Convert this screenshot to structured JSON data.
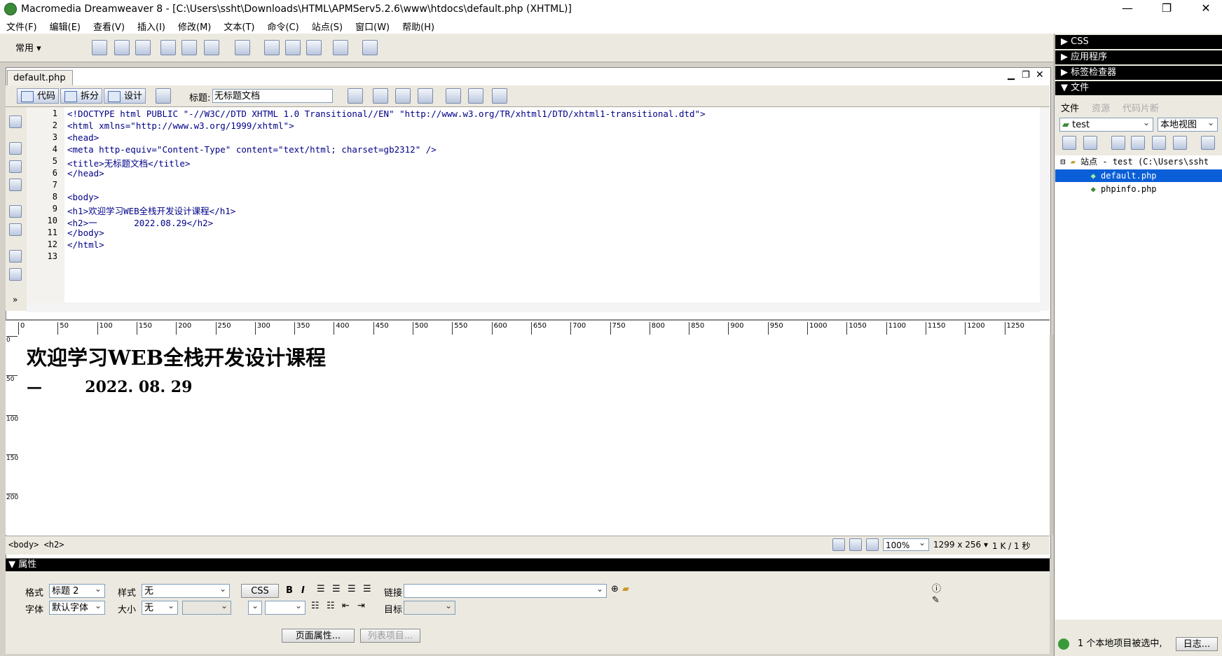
{
  "window": {
    "title": "Macromedia Dreamweaver 8 - [C:\\Users\\ssht\\Downloads\\HTML\\APMServ5.2.6\\www\\htdocs\\default.php (XHTML)]"
  },
  "menu": [
    "文件(F)",
    "编辑(E)",
    "查看(V)",
    "插入(I)",
    "修改(M)",
    "文本(T)",
    "命令(C)",
    "站点(S)",
    "窗口(W)",
    "帮助(H)"
  ],
  "insert_bar": {
    "category": "常用"
  },
  "document": {
    "tab": "default.php",
    "views": {
      "code": "代码",
      "split": "拆分",
      "design": "设计"
    },
    "title_label": "标题:",
    "title_value": "无标题文档"
  },
  "code": {
    "line_numbers": [
      "1",
      "2",
      "3",
      "4",
      "5",
      "6",
      "7",
      "8",
      "9",
      "10",
      "11",
      "12",
      "13"
    ],
    "lines": [
      "<!DOCTYPE html PUBLIC \"-//W3C//DTD XHTML 1.0 Transitional//EN\" \"http://www.w3.org/TR/xhtml1/DTD/xhtml1-transitional.dtd\">",
      "<html xmlns=\"http://www.w3.org/1999/xhtml\">",
      "<head>",
      "<meta http-equiv=\"Content-Type\" content=\"text/html; charset=gb2312\" />",
      "<title>无标题文档</title>",
      "</head>",
      "",
      "<body>",
      "<h1>欢迎学习WEB全栈开发设计课程</h1>",
      "<h2>一       2022.08.29</h2>",
      "</body>",
      "</html>",
      ""
    ]
  },
  "ruler_ticks": [
    "0",
    "50",
    "100",
    "150",
    "200",
    "250",
    "300",
    "350",
    "400",
    "450",
    "500",
    "550",
    "600",
    "650",
    "700",
    "750",
    "800",
    "850",
    "900",
    "950",
    "1000",
    "1050",
    "1100",
    "1150",
    "1200",
    "1250"
  ],
  "vruler_ticks": [
    "0",
    "50",
    "100",
    "150",
    "200"
  ],
  "design": {
    "h1": "欢迎学习WEB全栈开发设计课程",
    "h2": "—        2022. 08. 29"
  },
  "status": {
    "tag_selector": "<body> <h2>",
    "zoom": "100%",
    "dimensions": "1299 x 256",
    "size_time": "1 K / 1 秒"
  },
  "properties": {
    "header": "属性",
    "format_label": "格式",
    "format_value": "标题 2",
    "style_label": "样式",
    "style_value": "无",
    "css_button": "CSS",
    "bold": "B",
    "italic": "I",
    "link_label": "链接",
    "font_label": "字体",
    "font_value": "默认字体",
    "size_label": "大小",
    "size_value": "无",
    "target_label": "目标",
    "page_props_button": "页面属性...",
    "list_item_button": "列表项目..."
  },
  "right_panel": {
    "headers": [
      "CSS",
      "应用程序",
      "标签检查器",
      "文件"
    ],
    "tabs": [
      "文件",
      "资源",
      "代码片断"
    ],
    "site_select": "test",
    "view_select": "本地视图",
    "tree": {
      "root": "站点 - test (C:\\Users\\ssht",
      "files": [
        "default.php",
        "phpinfo.php"
      ]
    },
    "status": "1 个本地项目被选中,",
    "log_button": "日志..."
  },
  "colors": {
    "selection": "#0a5fd8",
    "panel_header": "#000000",
    "tag": "#000088",
    "string": "#0000ff"
  }
}
